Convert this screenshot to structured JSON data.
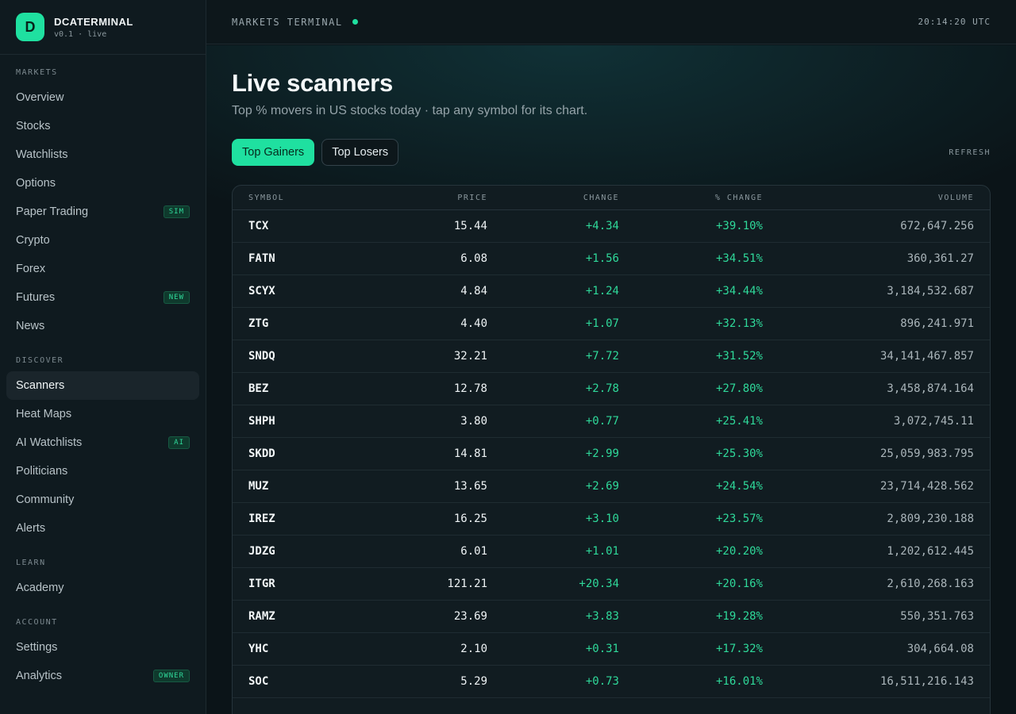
{
  "brand": {
    "logo_letter": "D",
    "name": "DCATERMINAL",
    "version": "v0.1 · live"
  },
  "sidebar": {
    "sections": [
      {
        "title": "MARKETS",
        "items": [
          {
            "label": "Overview"
          },
          {
            "label": "Stocks"
          },
          {
            "label": "Watchlists"
          },
          {
            "label": "Options"
          },
          {
            "label": "Paper Trading",
            "badge": "SIM"
          },
          {
            "label": "Crypto"
          },
          {
            "label": "Forex"
          },
          {
            "label": "Futures",
            "badge": "NEW"
          },
          {
            "label": "News"
          }
        ]
      },
      {
        "title": "DISCOVER",
        "items": [
          {
            "label": "Scanners",
            "active": true
          },
          {
            "label": "Heat Maps"
          },
          {
            "label": "AI Watchlists",
            "badge": "AI"
          },
          {
            "label": "Politicians"
          },
          {
            "label": "Community"
          },
          {
            "label": "Alerts"
          }
        ]
      },
      {
        "title": "LEARN",
        "items": [
          {
            "label": "Academy"
          }
        ]
      },
      {
        "title": "ACCOUNT",
        "items": [
          {
            "label": "Settings"
          },
          {
            "label": "Analytics",
            "badge": "OWNER"
          }
        ]
      }
    ]
  },
  "topbar": {
    "title": "MARKETS TERMINAL",
    "clock": "20:14:20 UTC"
  },
  "page": {
    "title": "Live scanners",
    "subtitle": "Top % movers in US stocks today · tap any symbol for its chart.",
    "tabs": [
      {
        "label": "Top Gainers",
        "active": true
      },
      {
        "label": "Top Losers"
      }
    ],
    "refresh_label": "REFRESH"
  },
  "table": {
    "columns": [
      "SYMBOL",
      "PRICE",
      "CHANGE",
      "% CHANGE",
      "VOLUME"
    ],
    "rows": [
      [
        "TCX",
        "15.44",
        "+4.34",
        "+39.10%",
        "672,647.256"
      ],
      [
        "FATN",
        "6.08",
        "+1.56",
        "+34.51%",
        "360,361.27"
      ],
      [
        "SCYX",
        "4.84",
        "+1.24",
        "+34.44%",
        "3,184,532.687"
      ],
      [
        "ZTG",
        "4.40",
        "+1.07",
        "+32.13%",
        "896,241.971"
      ],
      [
        "SNDQ",
        "32.21",
        "+7.72",
        "+31.52%",
        "34,141,467.857"
      ],
      [
        "BEZ",
        "12.78",
        "+2.78",
        "+27.80%",
        "3,458,874.164"
      ],
      [
        "SHPH",
        "3.80",
        "+0.77",
        "+25.41%",
        "3,072,745.11"
      ],
      [
        "SKDD",
        "14.81",
        "+2.99",
        "+25.30%",
        "25,059,983.795"
      ],
      [
        "MUZ",
        "13.65",
        "+2.69",
        "+24.54%",
        "23,714,428.562"
      ],
      [
        "IREZ",
        "16.25",
        "+3.10",
        "+23.57%",
        "2,809,230.188"
      ],
      [
        "JDZG",
        "6.01",
        "+1.01",
        "+20.20%",
        "1,202,612.445"
      ],
      [
        "ITGR",
        "121.21",
        "+20.34",
        "+20.16%",
        "2,610,268.163"
      ],
      [
        "RAMZ",
        "23.69",
        "+3.83",
        "+19.28%",
        "550,351.763"
      ],
      [
        "YHC",
        "2.10",
        "+0.31",
        "+17.32%",
        "304,664.08"
      ],
      [
        "SOC",
        "5.29",
        "+0.73",
        "+16.01%",
        "16,511,216.143"
      ]
    ]
  }
}
